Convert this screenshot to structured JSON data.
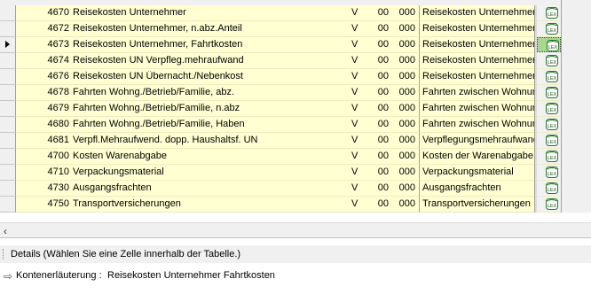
{
  "table": {
    "rows": [
      {
        "nr": "4670",
        "bezeichnung": "Reisekosten Unternehmer",
        "v": "V",
        "k1": "00",
        "k2": "000",
        "text": "Reisekosten Unternehmer",
        "selected": false
      },
      {
        "nr": "4672",
        "bezeichnung": "Reisekosten Unternehmer, n.abz.Anteil",
        "v": "V",
        "k1": "00",
        "k2": "000",
        "text": "Reisekosten Unternehmer",
        "selected": false
      },
      {
        "nr": "4673",
        "bezeichnung": "Reisekosten Unternehmer, Fahrtkosten",
        "v": "V",
        "k1": "00",
        "k2": "000",
        "text": "Reisekosten Unternehmer",
        "selected": true
      },
      {
        "nr": "4674",
        "bezeichnung": "Reisekosten UN Verpfleg.mehraufwand",
        "v": "V",
        "k1": "00",
        "k2": "000",
        "text": "Reisekosten Unternehmer",
        "selected": false
      },
      {
        "nr": "4676",
        "bezeichnung": "Reisekosten UN Übernacht./Nebenkost",
        "v": "V",
        "k1": "00",
        "k2": "000",
        "text": "Reisekosten Unternehmer",
        "selected": false
      },
      {
        "nr": "4678",
        "bezeichnung": "Fahrten Wohng./Betrieb/Familie, abz.",
        "v": "V",
        "k1": "00",
        "k2": "000",
        "text": "Fahrten zwischen Wohnung",
        "selected": false
      },
      {
        "nr": "4679",
        "bezeichnung": "Fahrten Wohng./Betrieb/Familie, n.abz",
        "v": "V",
        "k1": "00",
        "k2": "000",
        "text": "Fahrten zwischen Wohnung",
        "selected": false
      },
      {
        "nr": "4680",
        "bezeichnung": "Fahrten Wohng./Betrieb/Familie, Haben",
        "v": "V",
        "k1": "00",
        "k2": "000",
        "text": "Fahrten zwischen Wohnung",
        "selected": false
      },
      {
        "nr": "4681",
        "bezeichnung": "Verpfl.Mehraufwend. dopp. Haushaltsf. UN",
        "v": "V",
        "k1": "00",
        "k2": "000",
        "text": "Verpflegungsmehraufwand",
        "selected": false
      },
      {
        "nr": "4700",
        "bezeichnung": "Kosten Warenabgabe",
        "v": "V",
        "k1": "00",
        "k2": "000",
        "text": "Kosten der Warenabgabe",
        "selected": false
      },
      {
        "nr": "4710",
        "bezeichnung": "Verpackungsmaterial",
        "v": "V",
        "k1": "00",
        "k2": "000",
        "text": "Verpackungsmaterial",
        "selected": false
      },
      {
        "nr": "4730",
        "bezeichnung": "Ausgangsfrachten",
        "v": "V",
        "k1": "00",
        "k2": "000",
        "text": "Ausgangsfrachten",
        "selected": false
      },
      {
        "nr": "4750",
        "bezeichnung": "Transportversicherungen",
        "v": "V",
        "k1": "00",
        "k2": "000",
        "text": "Transportversicherungen",
        "selected": false
      }
    ],
    "lex_icon": "lex-document-icon"
  },
  "scrollbar": {
    "left_arrow": "‹"
  },
  "details": {
    "label": "Details (Wählen Sie eine Zelle innerhalb der Tabelle.)"
  },
  "kontenerlaeuterung": {
    "arrow": "⇨",
    "label": "Kontenerläuterung  :",
    "value": "Reisekosten Unternehmer Fahrtkosten"
  },
  "colors": {
    "row_bg": "#ffffd2",
    "selected_lex_bg": "#a8d890"
  }
}
